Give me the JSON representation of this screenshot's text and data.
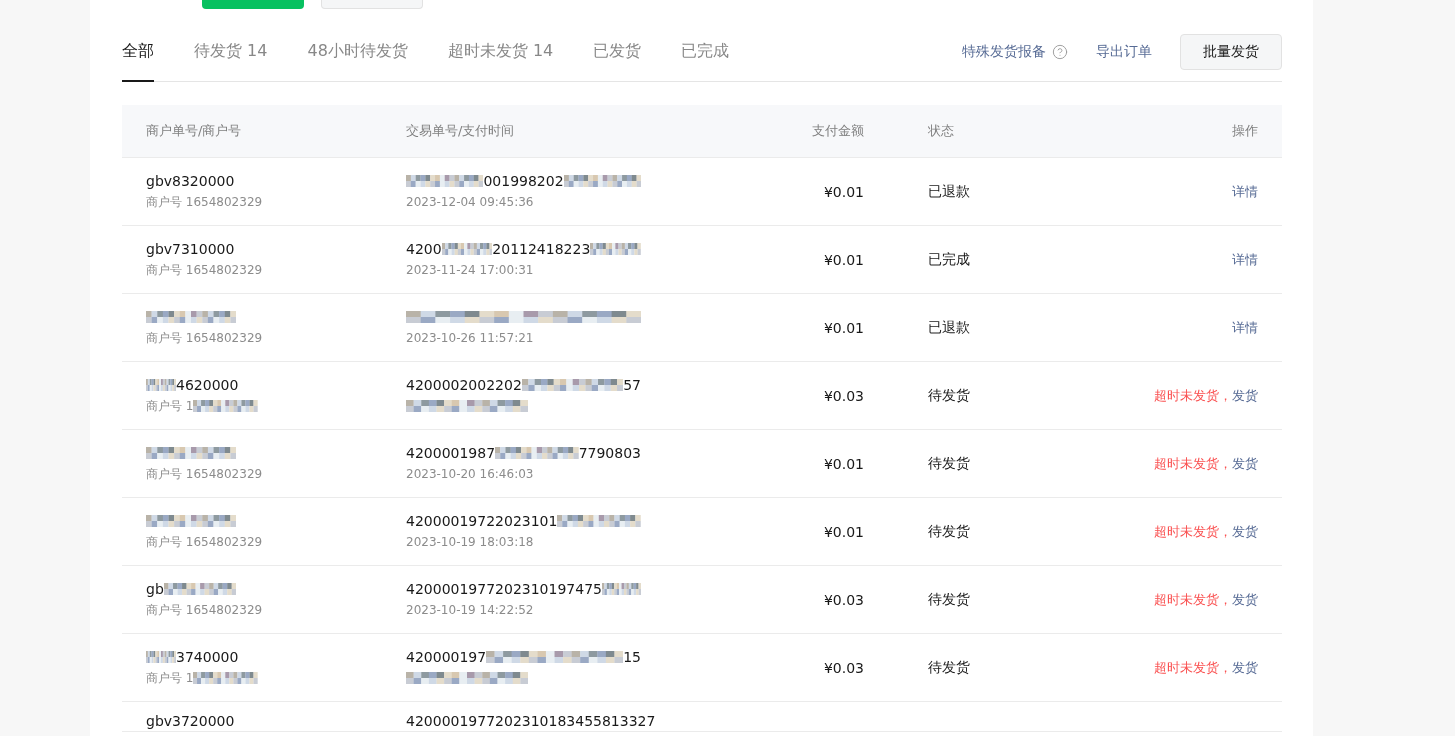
{
  "tabs": [
    {
      "label": "全部",
      "selected": true
    },
    {
      "label": "待发货 14",
      "selected": false
    },
    {
      "label": "48小时待发货",
      "selected": false
    },
    {
      "label": "超时未发货 14",
      "selected": false
    },
    {
      "label": "已发货",
      "selected": false
    },
    {
      "label": "已完成",
      "selected": false
    }
  ],
  "actions": {
    "special_report": "特殊发货报备",
    "export": "导出订单",
    "batch_ship": "批量发货"
  },
  "table": {
    "columns": [
      "商户单号/商户号",
      "交易单号/支付时间",
      "支付金额",
      "状态",
      "操作"
    ],
    "rows": [
      {
        "merchant": [
          {
            "kind": "text",
            "text": "gbv8320000"
          }
        ],
        "merchant_id": [
          {
            "kind": "text",
            "text": "商户号 1654802329"
          }
        ],
        "transaction": [
          {
            "kind": "mosaic"
          },
          {
            "kind": "text",
            "text": "001998202"
          },
          {
            "kind": "mosaic"
          }
        ],
        "time": [
          {
            "kind": "text",
            "text": "2023-12-04 09:45:36"
          }
        ],
        "amount": "¥0.01",
        "status": "已退款",
        "operations": [
          {
            "kind": "link",
            "text": "详情"
          }
        ]
      },
      {
        "merchant": [
          {
            "kind": "text",
            "text": "gbv7310000"
          }
        ],
        "merchant_id": [
          {
            "kind": "text",
            "text": "商户号 1654802329"
          }
        ],
        "transaction": [
          {
            "kind": "text",
            "text": "4200"
          },
          {
            "kind": "mosaic"
          },
          {
            "kind": "text",
            "text": "20112418223"
          },
          {
            "kind": "mosaic"
          }
        ],
        "time": [
          {
            "kind": "text",
            "text": "2023-11-24 17:00:31"
          }
        ],
        "amount": "¥0.01",
        "status": "已完成",
        "operations": [
          {
            "kind": "link",
            "text": "详情"
          }
        ]
      },
      {
        "merchant": [
          {
            "kind": "mosaic"
          }
        ],
        "merchant_id": [
          {
            "kind": "text",
            "text": "商户号 1654802329"
          }
        ],
        "transaction": [
          {
            "kind": "mosaic"
          }
        ],
        "time": [
          {
            "kind": "text",
            "text": "2023-10-26 11:57:21"
          }
        ],
        "amount": "¥0.01",
        "status": "已退款",
        "operations": [
          {
            "kind": "link",
            "text": "详情"
          }
        ]
      },
      {
        "merchant": [
          {
            "kind": "mosaic"
          },
          {
            "kind": "text",
            "text": "4620000"
          }
        ],
        "merchant_id": [
          {
            "kind": "text",
            "text": "商户号 1"
          },
          {
            "kind": "mosaic"
          }
        ],
        "transaction": [
          {
            "kind": "text",
            "text": "4200002002202"
          },
          {
            "kind": "mosaic"
          },
          {
            "kind": "text",
            "text": "57"
          }
        ],
        "time": [
          {
            "kind": "mosaic"
          }
        ],
        "amount": "¥0.03",
        "status": "待发货",
        "operations": [
          {
            "kind": "warning",
            "text": "超时未发货，"
          },
          {
            "kind": "link",
            "text": "发货"
          }
        ]
      },
      {
        "merchant": [
          {
            "kind": "mosaic"
          }
        ],
        "merchant_id": [
          {
            "kind": "text",
            "text": "商户号 1654802329"
          }
        ],
        "transaction": [
          {
            "kind": "text",
            "text": "4200001987"
          },
          {
            "kind": "mosaic"
          },
          {
            "kind": "text",
            "text": "7790803"
          }
        ],
        "time": [
          {
            "kind": "text",
            "text": "2023-10-20 16:46:03"
          }
        ],
        "amount": "¥0.01",
        "status": "待发货",
        "operations": [
          {
            "kind": "warning",
            "text": "超时未发货，"
          },
          {
            "kind": "link",
            "text": "发货"
          }
        ]
      },
      {
        "merchant": [
          {
            "kind": "mosaic"
          }
        ],
        "merchant_id": [
          {
            "kind": "text",
            "text": "商户号 1654802329"
          }
        ],
        "transaction": [
          {
            "kind": "text",
            "text": "42000019722023101"
          },
          {
            "kind": "mosaic"
          }
        ],
        "time": [
          {
            "kind": "text",
            "text": "2023-10-19 18:03:18"
          }
        ],
        "amount": "¥0.01",
        "status": "待发货",
        "operations": [
          {
            "kind": "warning",
            "text": "超时未发货，"
          },
          {
            "kind": "link",
            "text": "发货"
          }
        ]
      },
      {
        "merchant": [
          {
            "kind": "text",
            "text": "gb"
          },
          {
            "kind": "mosaic"
          }
        ],
        "merchant_id": [
          {
            "kind": "text",
            "text": "商户号 1654802329"
          }
        ],
        "transaction": [
          {
            "kind": "text",
            "text": "4200001977202310197475"
          },
          {
            "kind": "mosaic"
          }
        ],
        "time": [
          {
            "kind": "text",
            "text": "2023-10-19 14:22:52"
          }
        ],
        "amount": "¥0.03",
        "status": "待发货",
        "operations": [
          {
            "kind": "warning",
            "text": "超时未发货，"
          },
          {
            "kind": "link",
            "text": "发货"
          }
        ]
      },
      {
        "merchant": [
          {
            "kind": "mosaic"
          },
          {
            "kind": "text",
            "text": "3740000"
          }
        ],
        "merchant_id": [
          {
            "kind": "text",
            "text": "商户号 1"
          },
          {
            "kind": "mosaic"
          }
        ],
        "transaction": [
          {
            "kind": "text",
            "text": "420000197"
          },
          {
            "kind": "mosaic"
          },
          {
            "kind": "text",
            "text": "15"
          }
        ],
        "time": [
          {
            "kind": "mosaic"
          }
        ],
        "amount": "¥0.03",
        "status": "待发货",
        "operations": [
          {
            "kind": "warning",
            "text": "超时未发货，"
          },
          {
            "kind": "link",
            "text": "发货"
          }
        ]
      },
      {
        "merchant": [
          {
            "kind": "text",
            "text": "gbv3720000"
          }
        ],
        "transaction": [
          {
            "kind": "text",
            "text": "4200001977202310183455813327"
          }
        ]
      }
    ]
  }
}
